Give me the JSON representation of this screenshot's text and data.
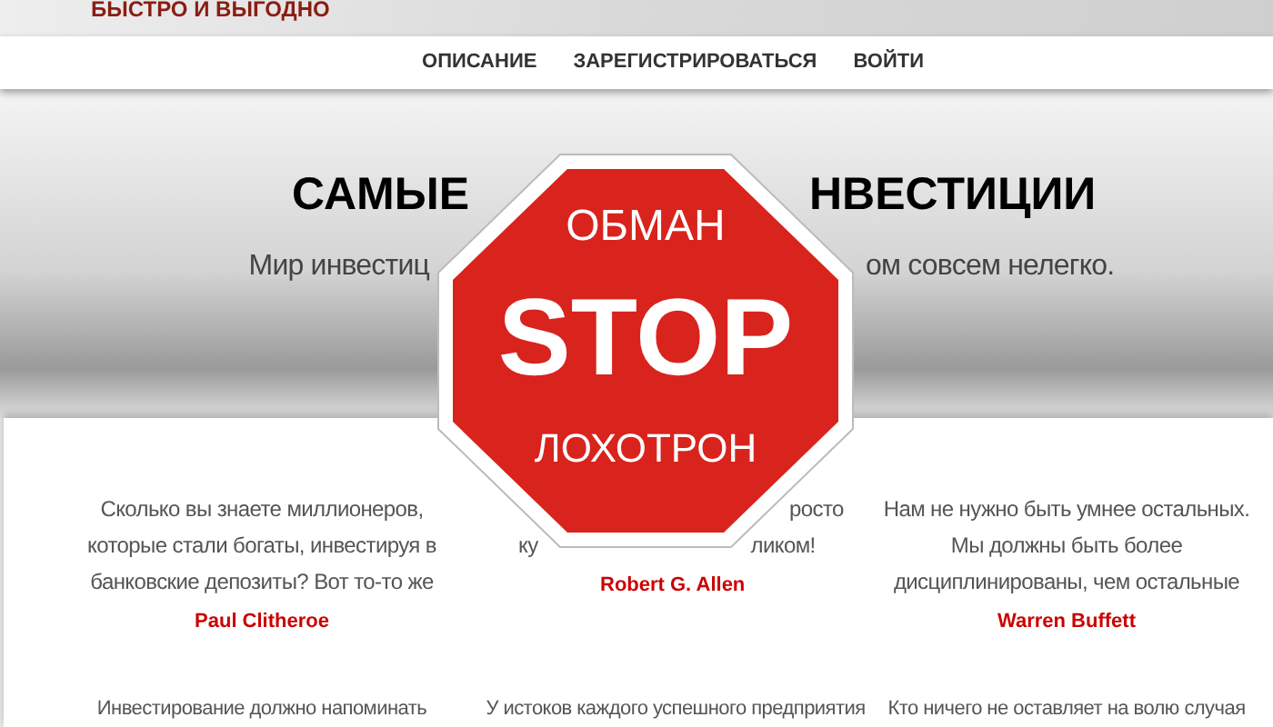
{
  "header": {
    "tagline": "БЫСТРО И ВЫГОДНО"
  },
  "nav": [
    {
      "label": "ОПИСАНИЕ"
    },
    {
      "label": "ЗАРЕГИСТРИРОВАТЬСЯ"
    },
    {
      "label": "ВОЙТИ"
    }
  ],
  "hero": {
    "title_left": "САМЫЕ",
    "title_right": "НВЕСТИЦИИ",
    "subtitle_left": "Мир инвестиц",
    "subtitle_right": "ом совсем нелегко."
  },
  "quotes": [
    {
      "kind": "full",
      "text": "Сколько вы знаете миллионеров, которые стали богаты, инвестируя в банковские депозиты? Вот то-то же",
      "author": "Paul Clitheroe"
    },
    {
      "kind": "covered",
      "line_1_end": "росто",
      "line_2_start": "ку",
      "line_2_end": "ликом!",
      "author": "Robert G. Allen"
    },
    {
      "kind": "full",
      "text": "Нам не нужно быть умнее остальных. Мы должны быть более дисциплинированы, чем остальные",
      "author": "Warren Buffett"
    }
  ],
  "quotes_row_2": [
    "Инвестирование должно напоминать",
    "У истоков каждого успешного предприятия",
    "Кто ничего не оставляет на волю случая"
  ],
  "stop_sign": {
    "top": "ОБМАН",
    "middle": "STOP",
    "bottom": "ЛОХОТРОН"
  }
}
